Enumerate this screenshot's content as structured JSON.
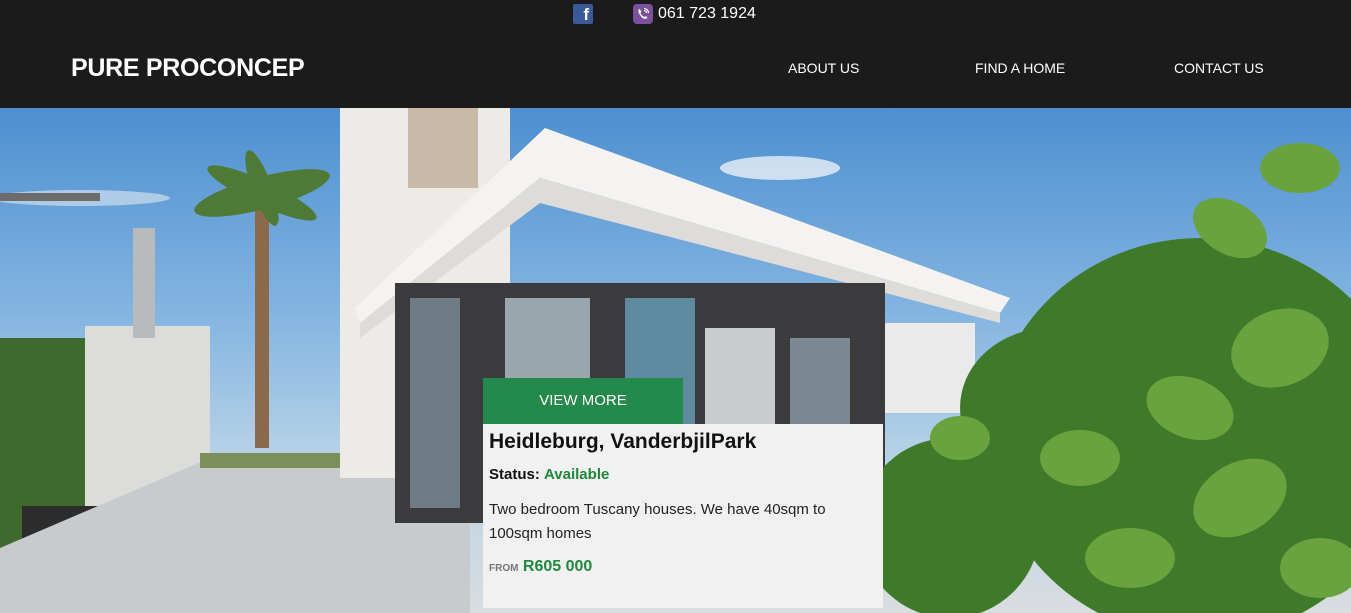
{
  "header": {
    "phone": "061 723 1924",
    "brand": "PURE PROCONCEP",
    "nav": [
      {
        "label": "ABOUT US"
      },
      {
        "label": "FIND A HOME"
      },
      {
        "label": "CONTACT US"
      }
    ]
  },
  "listing": {
    "button_label": "VIEW MORE",
    "title": "Heidleburg, VanderbjilPark",
    "status_label": "Status:",
    "status_value": "Available",
    "description": "Two bedroom Tuscany houses. We have 40sqm to 100sqm homes",
    "price_prefix": "FROM",
    "price": "R605 000"
  },
  "colors": {
    "header_bg": "#1b1b1b",
    "accent_green": "#238a4c",
    "facebook": "#3b5998",
    "viber": "#7b519d"
  },
  "icons": [
    "facebook-icon",
    "viber-icon"
  ]
}
